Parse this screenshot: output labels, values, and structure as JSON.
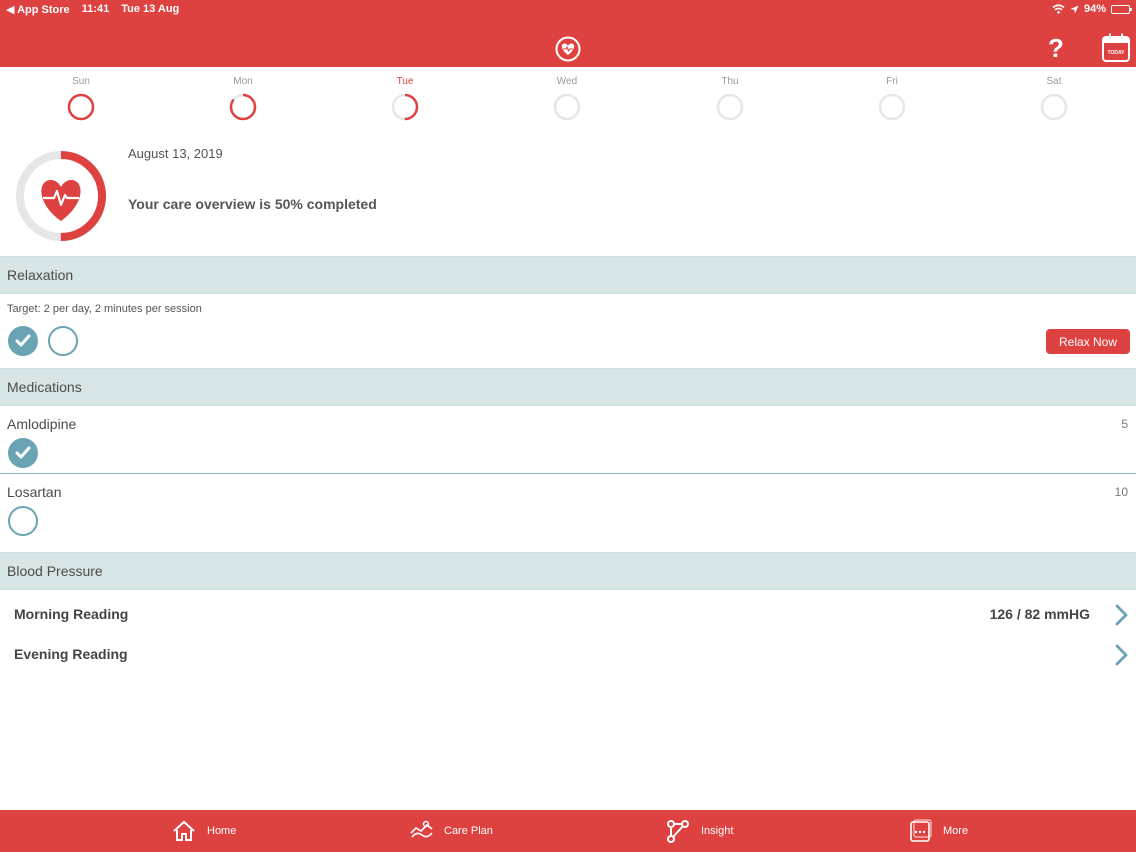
{
  "status_bar": {
    "back_app": "App Store",
    "time": "11:41",
    "date": "Tue 13 Aug",
    "battery": "94%",
    "battery_level": 0.94
  },
  "header": {
    "logo_icon": "heart-badge-icon",
    "help_label": "?",
    "calendar_label": "TODAY"
  },
  "week": [
    {
      "label": "Sun",
      "progress": 1.0,
      "today": false
    },
    {
      "label": "Mon",
      "progress": 0.85,
      "today": false
    },
    {
      "label": "Tue",
      "progress": 0.5,
      "today": true
    },
    {
      "label": "Wed",
      "progress": 0,
      "today": false
    },
    {
      "label": "Thu",
      "progress": 0,
      "today": false
    },
    {
      "label": "Fri",
      "progress": 0,
      "today": false
    },
    {
      "label": "Sat",
      "progress": 0,
      "today": false
    }
  ],
  "overview": {
    "date": "August 13, 2019",
    "summary": "Your care overview is 50% completed",
    "progress": 0.5
  },
  "relaxation": {
    "title": "Relaxation",
    "target": "Target: 2 per day, 2 minutes per session",
    "sessions_done": [
      true,
      false
    ],
    "button_label": "Relax Now"
  },
  "medications": {
    "title": "Medications",
    "items": [
      {
        "name": "Amlodipine",
        "count": "5",
        "done": true
      },
      {
        "name": "Losartan",
        "count": "10",
        "done": false
      }
    ]
  },
  "blood_pressure": {
    "title": "Blood Pressure",
    "readings": [
      {
        "name": "Morning Reading",
        "value": "126 / 82 mmHG"
      },
      {
        "name": "Evening Reading",
        "value": ""
      }
    ]
  },
  "tabs": [
    {
      "label": "Home",
      "icon": "home-icon"
    },
    {
      "label": "Care Plan",
      "icon": "care-plan-icon"
    },
    {
      "label": "Insight",
      "icon": "insight-icon"
    },
    {
      "label": "More",
      "icon": "more-icon"
    }
  ],
  "colors": {
    "brand_red": "#de4240",
    "accent_teal": "#6aa3b4",
    "section_bg": "#d8e5e6",
    "ring_track": "#e6e6e6"
  }
}
